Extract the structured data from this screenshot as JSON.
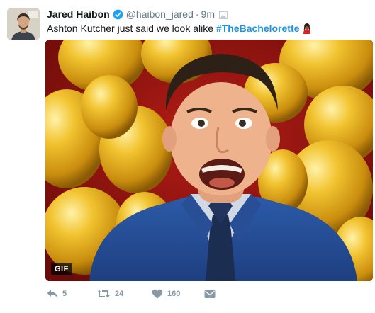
{
  "tweet": {
    "display_name": "Jared Haibon",
    "handle": "@haibon_jared",
    "separator": "·",
    "time": "9m",
    "text_before": "Ashton Kutcher just said we look alike",
    "hashtag": "#TheBachelorette",
    "media_badge": "GIF"
  },
  "actions": {
    "reply_count": "5",
    "retweet_count": "24",
    "like_count": "160"
  },
  "colors": {
    "link": "#1b95e0",
    "muted": "#657786",
    "action": "#8899a6",
    "balloon": "#e8b524"
  },
  "icons": [
    "verified-icon",
    "media-icon",
    "emoji-icon",
    "reply-icon",
    "retweet-icon",
    "like-icon",
    "direct-message-icon"
  ]
}
